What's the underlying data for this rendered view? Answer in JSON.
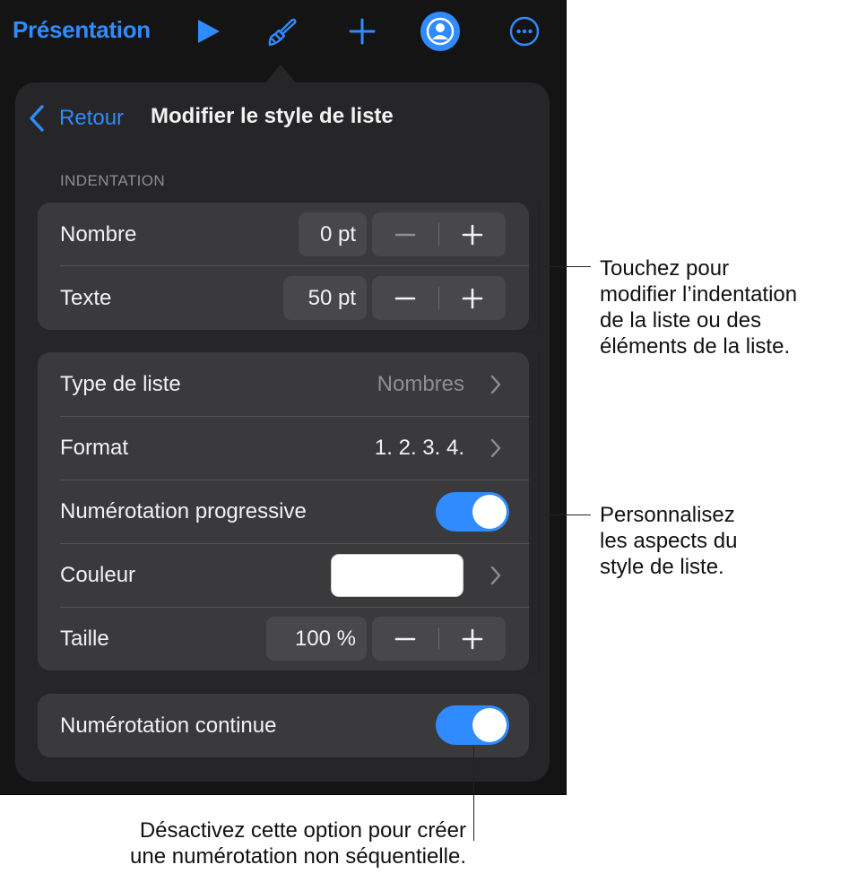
{
  "toolbar": {
    "title": "Présentation",
    "icons": [
      "play-icon",
      "paintbrush-icon",
      "plus-icon",
      "collaborate-icon",
      "more-icon"
    ]
  },
  "panel": {
    "back_label": "Retour",
    "title": "Modifier le style de liste",
    "section_indentation": "INDENTATION",
    "indentation_rows": [
      {
        "label": "Nombre",
        "value": "0 pt"
      },
      {
        "label": "Texte",
        "value": "50 pt"
      }
    ],
    "style_rows": {
      "type_label": "Type de liste",
      "type_value": "Nombres",
      "format_label": "Format",
      "format_value": "1. 2. 3. 4.",
      "progressive_label": "Numérotation progressive",
      "progressive_on": true,
      "color_label": "Couleur",
      "color_value": "#ffffff",
      "size_label": "Taille",
      "size_value": "100 %"
    },
    "continuous_label": "Numérotation continue",
    "continuous_on": true
  },
  "callouts": {
    "indentation": "Touchez pour\nmodifier l’indentation\nde la liste ou des\néléments de la liste.",
    "customize": "Personnalisez\nles aspects du\nstyle de liste.",
    "continuous": "Désactivez cette option pour créer\nune numérotation non séquentielle."
  },
  "colors": {
    "accent": "#2f8bff",
    "background": "#141414",
    "panel": "#262628",
    "group": "#3a3a3c",
    "control": "#48484a",
    "secondary_text": "#8e8e93"
  }
}
